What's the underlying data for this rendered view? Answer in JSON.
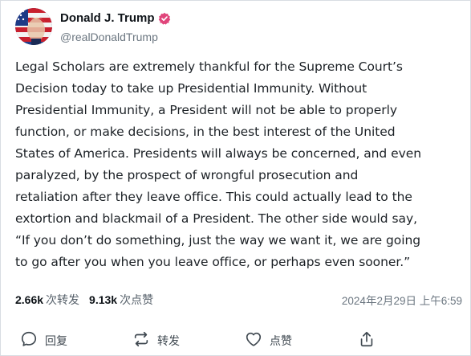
{
  "user": {
    "display_name": "Donald J. Trump",
    "handle": "@realDonaldTrump",
    "avatar_icon": "avatar-flag-portrait",
    "verified_icon": "verified-badge-icon",
    "verified_color": "#e0457b"
  },
  "post": {
    "text": "Legal Scholars are extremely thankful for the Supreme Court’s\nDecision today to take up Presidential Immunity. Without\nPresidential Immunity, a President will not be able to properly\nfunction, or make decisions, in the best interest of the United\nStates of America. Presidents will always be concerned, and even\nparalyzed, by the prospect of wrongful prosecution and\nretaliation after they leave office. This could actually lead to the\nextortion and blackmail of a President. The other side would say,\n“If you don’t do something, just the way we want it, we are going\nto go after you when you leave office, or perhaps even sooner.”"
  },
  "stats": {
    "reposts_count": "2.66k",
    "reposts_label": "次转发",
    "likes_count": "9.13k",
    "likes_label": "次点赞",
    "timestamp": "2024年2月29日 上午6:59"
  },
  "actions": {
    "reply_label": "回复",
    "repost_label": "转发",
    "like_label": "点赞",
    "reply_icon": "comment-icon",
    "repost_icon": "repost-icon",
    "like_icon": "heart-icon",
    "share_icon": "share-icon"
  },
  "colors": {
    "text": "#1c2126",
    "muted": "#6b7680",
    "border": "#d8dde2"
  }
}
